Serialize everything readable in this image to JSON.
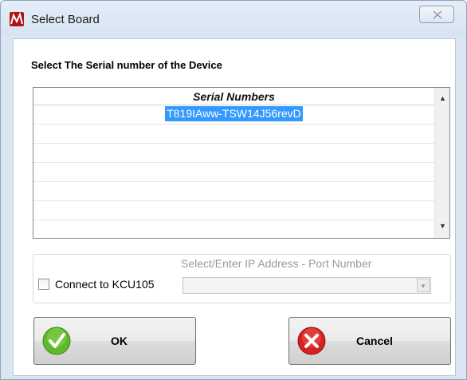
{
  "window": {
    "title": "Select Board",
    "app_icon": "app-logo-icon",
    "close_icon": "close-icon"
  },
  "heading": "Select The Serial number of the Device",
  "serial_list": {
    "column_header": "Serial Numbers",
    "rows": [
      "T819IAww-TSW14J56revD",
      "",
      "",
      "",
      "",
      "",
      ""
    ],
    "selected_index": 0
  },
  "connection": {
    "caption": "Select/Enter IP Address - Port Number",
    "checkbox_label": "Connect to KCU105",
    "checked": false,
    "ip_value": ""
  },
  "buttons": {
    "ok": {
      "label": "OK",
      "icon": "checkmark-icon"
    },
    "cancel": {
      "label": "Cancel",
      "icon": "cancel-x-icon"
    }
  },
  "colors": {
    "selection": "#3399ff",
    "ok_green": "#5fb92d",
    "cancel_red": "#d32222"
  }
}
